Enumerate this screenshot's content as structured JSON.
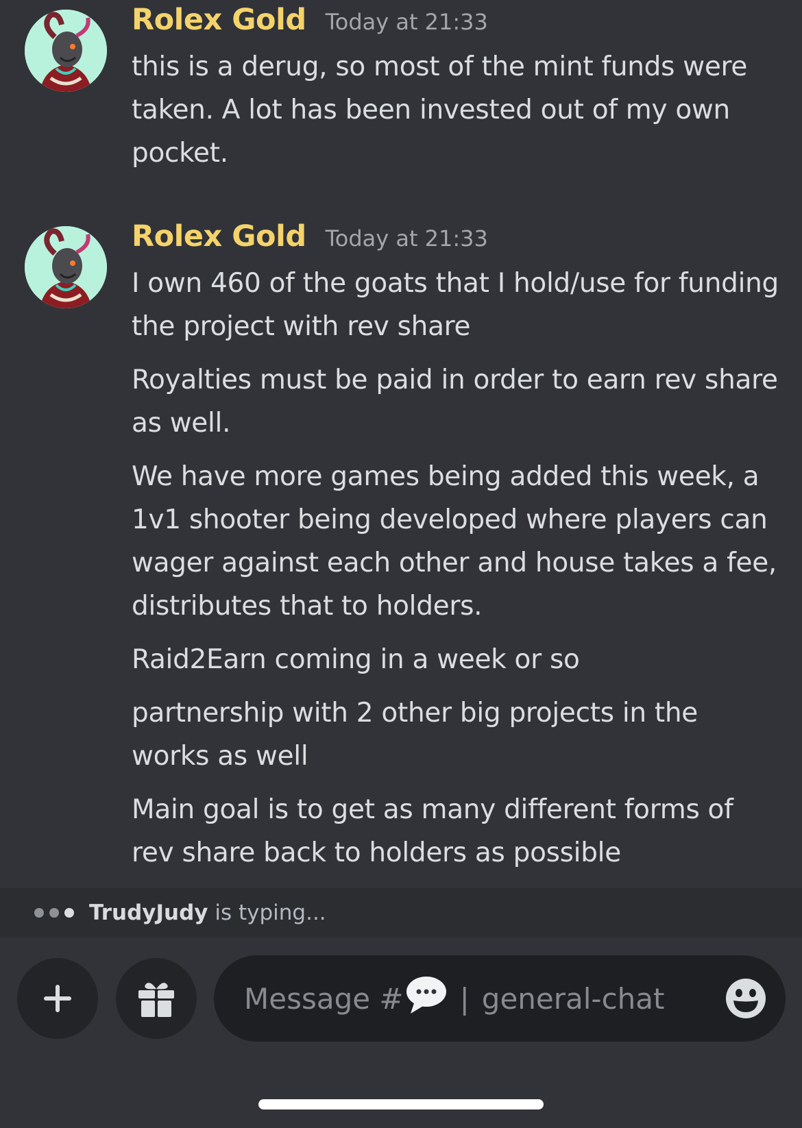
{
  "messages": [
    {
      "author": "Rolex Gold",
      "timestamp": "Today at 21:33",
      "lines": [
        "this is a derug, so most of the mint funds were taken. A lot has been invested out of my own pocket."
      ]
    },
    {
      "author": "Rolex Gold",
      "timestamp": "Today at 21:33",
      "lines": [
        "I own 460 of the goats that I hold/use for funding the project with rev share",
        "Royalties must be paid in order to earn rev share as well.",
        "We have more games being added this week, a 1v1 shooter being developed where players can wager against each other and house takes a fee, distributes that to holders.",
        "Raid2Earn coming in a week or so",
        "partnership with 2 other big projects in the works as well",
        "Main goal is to get as many different forms of rev share back to holders as possible"
      ]
    }
  ],
  "typing": {
    "user": "TrudyJudy",
    "suffix": " is typing..."
  },
  "composer": {
    "placeholder_prefix": "Message #",
    "channel": "general-chat",
    "separator": "|"
  },
  "icons": {
    "add": "plus-icon",
    "gift": "gift-icon",
    "emoji": "emoji-icon",
    "channel": "speech-bubble-icon"
  },
  "colors": {
    "background": "#313338",
    "author": "#f5d36b",
    "text": "#dbdee1",
    "input": "#1e1f22"
  }
}
